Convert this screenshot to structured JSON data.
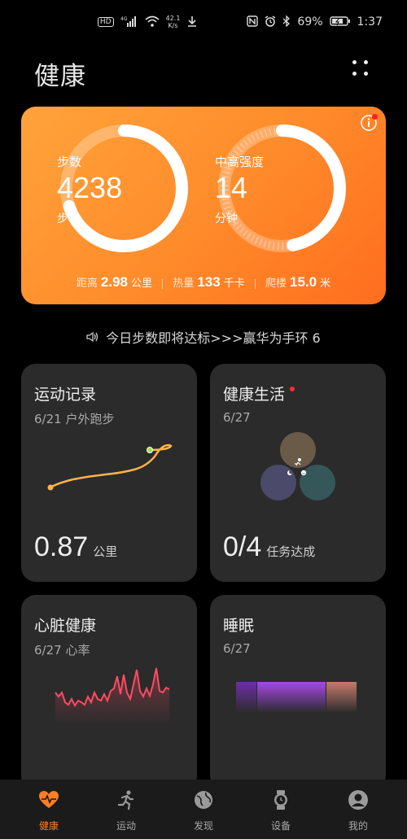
{
  "status_bar": {
    "hd": "HD",
    "signal": "4G",
    "speed_top": "42.1",
    "speed_bottom": "K/s",
    "battery": "69%",
    "time": "1:37"
  },
  "header": {
    "title": "健康"
  },
  "summary": {
    "steps": {
      "label": "步数",
      "value": "4238",
      "unit": "步",
      "progress": 0.7
    },
    "intensity": {
      "label": "中高强度",
      "value": "14",
      "unit": "分钟",
      "progress": 0.47
    },
    "stats": [
      {
        "label": "距离",
        "value": "2.98",
        "unit": "公里"
      },
      {
        "label": "热量",
        "value": "133",
        "unit": "千卡"
      },
      {
        "label": "爬楼",
        "value": "15.0",
        "unit": "米"
      }
    ]
  },
  "notice": {
    "text": "今日步数即将达标>>>赢华为手环 6"
  },
  "cards": {
    "exercise": {
      "title": "运动记录",
      "sub": "6/21 户外跑步",
      "value": "0.87",
      "unit": "公里"
    },
    "healthy_living": {
      "title": "健康生活",
      "sub": "6/27",
      "value": "0/4",
      "unit": "任务达成"
    },
    "heart": {
      "title": "心脏健康",
      "sub": "6/27 心率"
    },
    "sleep": {
      "title": "睡眠",
      "sub": "6/27"
    }
  },
  "colors": {
    "accent": "#ff7d25",
    "hero_start": "#ffa33a",
    "hero_end": "#ff6d1e",
    "heart_line": "#ff4b62",
    "sleep_deep": "#6f2fa8",
    "sleep_light": "#a848e8",
    "sleep_rem": "#ff8f6e"
  },
  "tabs": [
    {
      "label": "健康",
      "icon": "heart-pulse-icon",
      "active": true
    },
    {
      "label": "运动",
      "icon": "running-icon",
      "active": false
    },
    {
      "label": "发现",
      "icon": "globe-icon",
      "active": false
    },
    {
      "label": "设备",
      "icon": "watch-icon",
      "active": false
    },
    {
      "label": "我的",
      "icon": "user-icon",
      "active": false
    }
  ]
}
